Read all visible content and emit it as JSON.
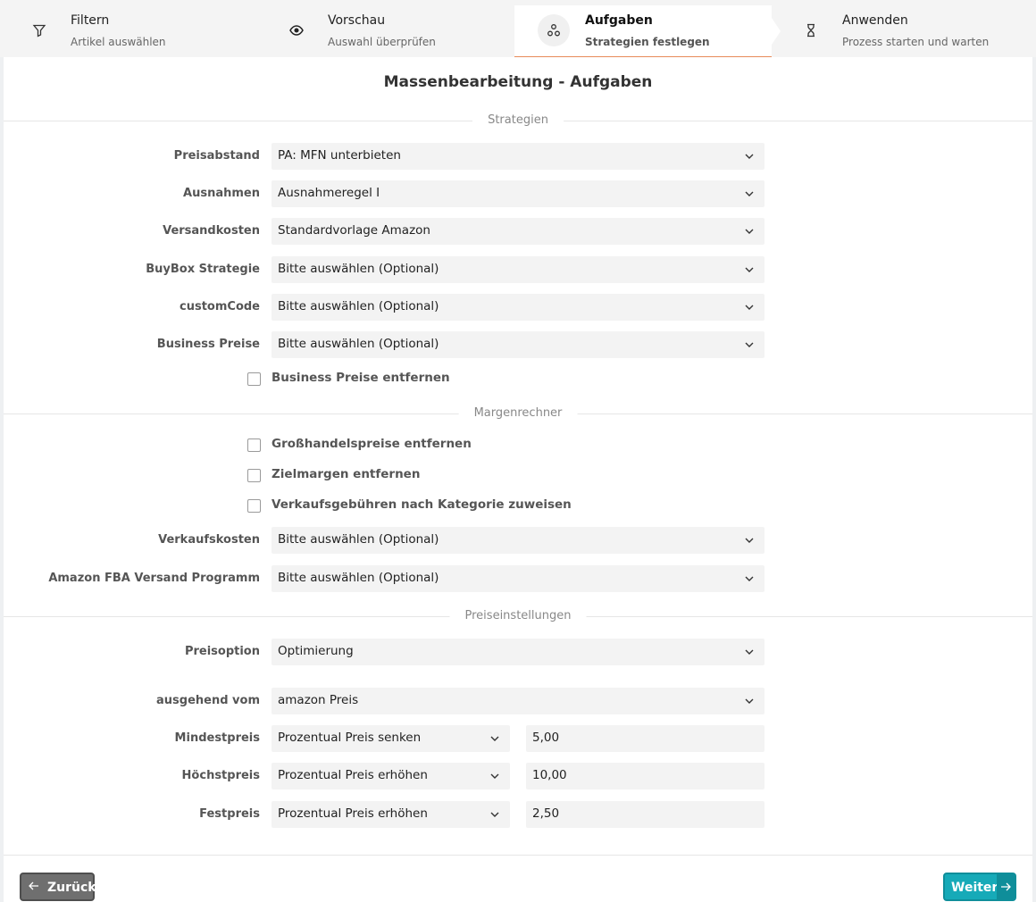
{
  "steps": [
    {
      "title": "Filtern",
      "subtitle": "Artikel auswählen",
      "icon": "filter-icon"
    },
    {
      "title": "Vorschau",
      "subtitle": "Auswahl überprüfen",
      "icon": "eye-icon"
    },
    {
      "title": "Aufgaben",
      "subtitle": "Strategien festlegen",
      "icon": "tasks-icon"
    },
    {
      "title": "Anwenden",
      "subtitle": "Prozess starten und warten",
      "icon": "hourglass-icon"
    }
  ],
  "page": {
    "title": "Massenbearbeitung - Aufgaben"
  },
  "sections": {
    "strategies": "Strategien",
    "margins": "Margenrechner",
    "pricing": "Preiseinstellungen"
  },
  "fields": {
    "preisabstand": {
      "label": "Preisabstand",
      "value": "PA: MFN unterbieten"
    },
    "ausnahmen": {
      "label": "Ausnahmen",
      "value": "Ausnahmeregel I"
    },
    "versandkosten": {
      "label": "Versandkosten",
      "value": "Standardvorlage Amazon"
    },
    "buybox": {
      "label": "BuyBox Strategie",
      "value": "Bitte auswählen (Optional)"
    },
    "customcode": {
      "label": "customCode",
      "value": "Bitte auswählen (Optional)"
    },
    "business_preise": {
      "label": "Business Preise",
      "value": "Bitte auswählen (Optional)"
    },
    "verkaufskosten": {
      "label": "Verkaufskosten",
      "value": "Bitte auswählen (Optional)"
    },
    "fba_programm": {
      "label": "Amazon FBA Versand Programm",
      "value": "Bitte auswählen (Optional)"
    },
    "preisoption": {
      "label": "Preisoption",
      "value": "Optimierung"
    },
    "ausgehend": {
      "label": "ausgehend vom",
      "value": "amazon Preis"
    },
    "mindestpreis": {
      "label": "Mindestpreis",
      "mode": "Prozentual Preis senken",
      "amount": "5,00"
    },
    "hoechstpreis": {
      "label": "Höchstpreis",
      "mode": "Prozentual Preis erhöhen",
      "amount": "10,00"
    },
    "festpreis": {
      "label": "Festpreis",
      "mode": "Prozentual Preis erhöhen",
      "amount": "2,50"
    }
  },
  "checkboxes": {
    "business_remove": {
      "label": "Business Preise entfernen",
      "checked": false
    },
    "wholesale_remove": {
      "label": "Großhandelspreise entfernen",
      "checked": false
    },
    "target_margin_remove": {
      "label": "Zielmargen entfernen",
      "checked": false
    },
    "fees_by_category": {
      "label": "Verkaufsgebühren nach Kategorie zuweisen",
      "checked": false
    }
  },
  "buttons": {
    "back": "Zurück",
    "next": "Weiter"
  },
  "colors": {
    "accent": "#16aab8",
    "active_step_underline": "#e88b5a",
    "back_button": "#6f6f6f"
  }
}
